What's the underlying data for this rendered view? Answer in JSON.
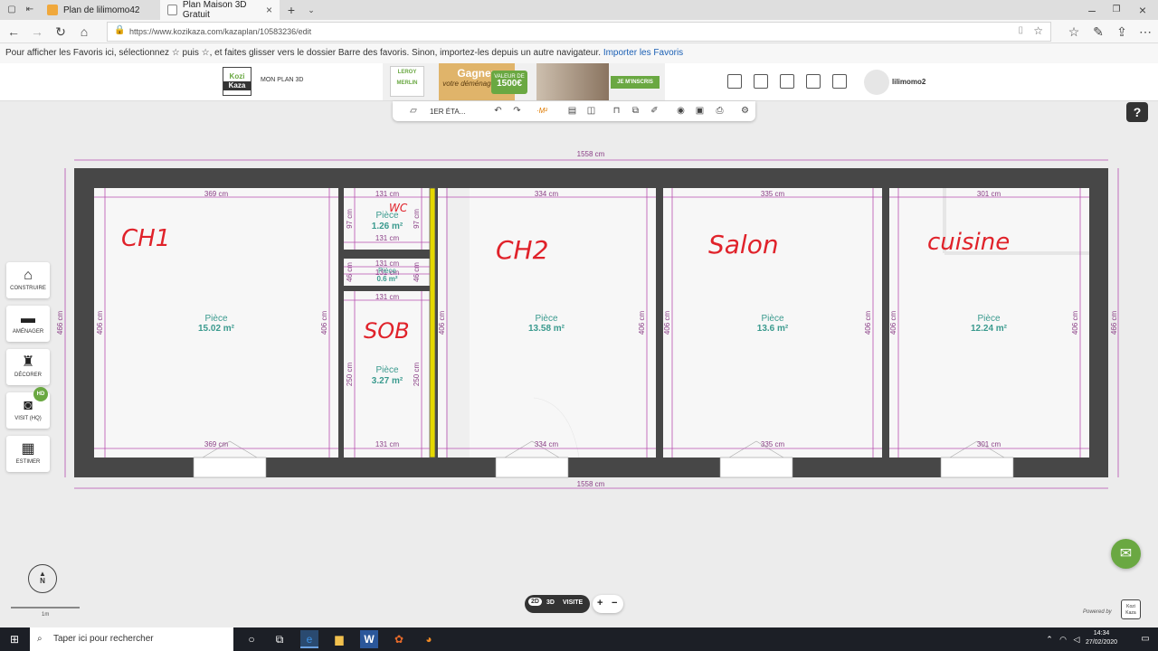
{
  "browser": {
    "tabs": [
      {
        "title": "Plan de lilimomo42"
      },
      {
        "title": "Plan Maison 3D Gratuit"
      }
    ],
    "url": "https://www.kozikaza.com/kazaplan/10583236/edit",
    "favorites_hint": "Pour afficher les Favoris ici, sélectionnez ☆ puis ☆, et faites glisser vers le dossier Barre des favoris. Sinon, importez-les depuis un autre navigateur.",
    "favorites_link": "Importer les Favoris"
  },
  "header": {
    "logo_top": "Kozi",
    "logo_bottom": "Kaza",
    "plan_label": "MON PLAN 3D",
    "ad": {
      "brand": "LEROY MERLIN",
      "headline": "Gagnez",
      "subline": "votre déménagement",
      "value_label": "VALEUR DE",
      "value": "1500€",
      "cta": "JE M'INSCRIS"
    },
    "username": "lilimomo2"
  },
  "toolbar": {
    "floor_label": "1ER ÉTA...",
    "m2_label": "·M²"
  },
  "sidebar": [
    {
      "label": "CONSTRUIRE",
      "icon": "house-icon"
    },
    {
      "label": "AMÉNAGER",
      "icon": "sofa-icon"
    },
    {
      "label": "DÉCORER",
      "icon": "lamp-icon"
    },
    {
      "label": "VISIT (HQ)",
      "icon": "camera-icon",
      "badge": "HD"
    },
    {
      "label": "ESTIMER",
      "icon": "estimate-icon"
    }
  ],
  "plan": {
    "total_width": "1558 cm",
    "total_height": "466 cm",
    "rooms": [
      {
        "id": "ch1",
        "name": "Pièce",
        "area": "15.02 m²",
        "width": "369 cm",
        "height": "406 cm",
        "handwritten": "CH1"
      },
      {
        "id": "wc",
        "name": "Pièce",
        "area": "1.26 m²",
        "width": "131 cm",
        "height": "97 cm",
        "handwritten": "WC"
      },
      {
        "id": "hall",
        "name": "Pièce",
        "area": "0.6 m²",
        "width": "131 cm",
        "height": "46 cm"
      },
      {
        "id": "sdb",
        "name": "Pièce",
        "area": "3.27 m²",
        "width": "131 cm",
        "height": "250 cm",
        "handwritten": "SOB"
      },
      {
        "id": "ch2",
        "name": "Pièce",
        "area": "13.58 m²",
        "width": "334 cm",
        "height": "406 cm",
        "handwritten": "CH2"
      },
      {
        "id": "salon",
        "name": "Pièce",
        "area": "13.6 m²",
        "width": "335 cm",
        "height": "406 cm",
        "handwritten": "Salon"
      },
      {
        "id": "cuisine",
        "name": "Pièce",
        "area": "12.24 m²",
        "width": "301 cm",
        "height": "406 cm",
        "handwritten": "cuisine"
      }
    ]
  },
  "view": {
    "mode_2d": "2D",
    "mode_3d": "3D",
    "mode_visit": "VISITE",
    "zoom_in": "+",
    "zoom_out": "−"
  },
  "scale": {
    "label": "1m"
  },
  "compass": {
    "label": "N"
  },
  "powered": {
    "label": "Powered by",
    "logo_top": "Kozi",
    "logo_bottom": "Kaza"
  },
  "taskbar": {
    "search_placeholder": "Taper ici pour rechercher",
    "time": "14:34",
    "date": "27/02/2020"
  }
}
